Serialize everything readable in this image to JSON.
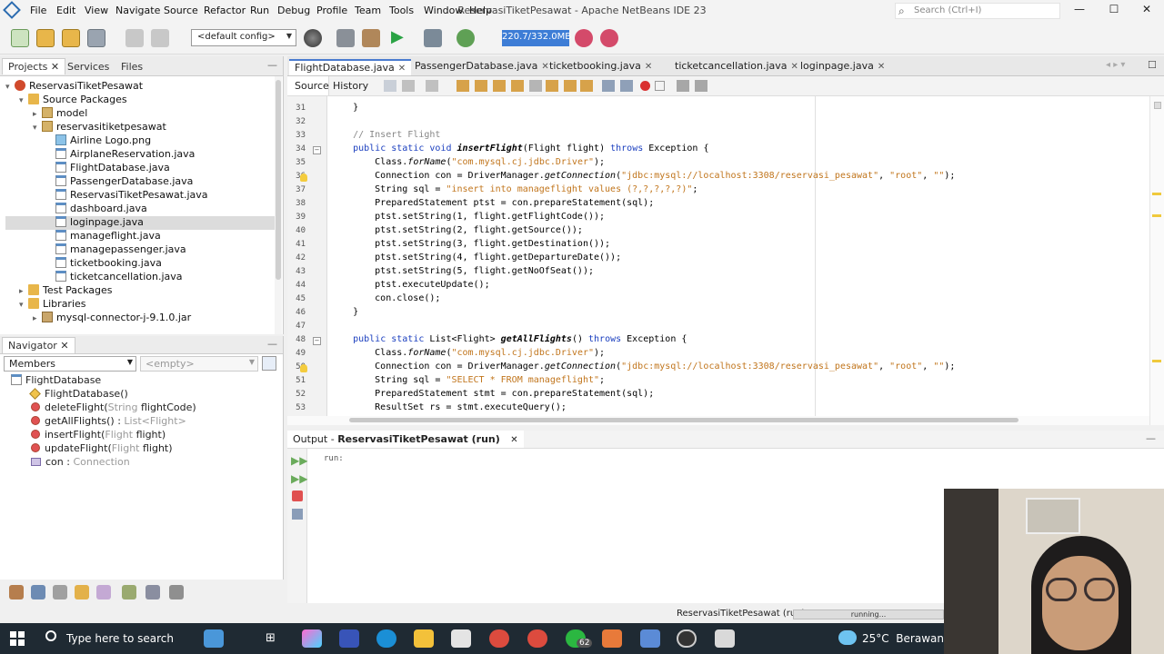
{
  "window": {
    "title": "ReservasiTiketPesawat - Apache NetBeans IDE 23",
    "search_placeholder": "Search (Ctrl+I)"
  },
  "menu": [
    "File",
    "Edit",
    "View",
    "Navigate",
    "Source",
    "Refactor",
    "Run",
    "Debug",
    "Profile",
    "Team",
    "Tools",
    "Window",
    "Help"
  ],
  "toolbar": {
    "config": "<default config>",
    "memory": "220.7/332.0MB"
  },
  "projects": {
    "tabs": [
      "Projects",
      "Services",
      "Files"
    ],
    "tree": [
      {
        "label": "ReservasiTiketPesawat",
        "depth": 0,
        "icon": "project-icon",
        "exp": "▾"
      },
      {
        "label": "Source Packages",
        "depth": 1,
        "icon": "folder-icon",
        "exp": "▾"
      },
      {
        "label": "model",
        "depth": 2,
        "icon": "package-icon",
        "exp": "▸"
      },
      {
        "label": "reservasitiketpesawat",
        "depth": 2,
        "icon": "package-icon",
        "exp": "▾"
      },
      {
        "label": "Airline Logo.png",
        "depth": 3,
        "icon": "image-file-icon",
        "exp": ""
      },
      {
        "label": "AirplaneReservation.java",
        "depth": 3,
        "icon": "java-file-icon",
        "exp": ""
      },
      {
        "label": "FlightDatabase.java",
        "depth": 3,
        "icon": "java-file-icon",
        "exp": ""
      },
      {
        "label": "PassengerDatabase.java",
        "depth": 3,
        "icon": "java-file-icon",
        "exp": ""
      },
      {
        "label": "ReservasiTiketPesawat.java",
        "depth": 3,
        "icon": "java-file-icon",
        "exp": ""
      },
      {
        "label": "dashboard.java",
        "depth": 3,
        "icon": "java-file-icon",
        "exp": ""
      },
      {
        "label": "loginpage.java",
        "depth": 3,
        "icon": "java-file-icon",
        "exp": "",
        "selected": true
      },
      {
        "label": "manageflight.java",
        "depth": 3,
        "icon": "java-file-icon",
        "exp": ""
      },
      {
        "label": "managepassenger.java",
        "depth": 3,
        "icon": "java-file-icon",
        "exp": ""
      },
      {
        "label": "ticketbooking.java",
        "depth": 3,
        "icon": "java-file-icon",
        "exp": ""
      },
      {
        "label": "ticketcancellation.java",
        "depth": 3,
        "icon": "java-file-icon",
        "exp": ""
      },
      {
        "label": "Test Packages",
        "depth": 1,
        "icon": "folder-icon",
        "exp": "▸"
      },
      {
        "label": "Libraries",
        "depth": 1,
        "icon": "folder-icon",
        "exp": "▾"
      },
      {
        "label": "mysql-connector-j-9.1.0.jar",
        "depth": 2,
        "icon": "jar-icon",
        "exp": "▸"
      }
    ]
  },
  "navigator": {
    "title": "Navigator",
    "filter": "Members",
    "filter2": "<empty>",
    "items": [
      {
        "name": "FlightDatabase",
        "type": "",
        "kind": "class"
      },
      {
        "name": "FlightDatabase()",
        "type": "",
        "kind": "ctor"
      },
      {
        "name": "deleteFlight(",
        "type": "String",
        "rest": " flightCode)",
        "kind": "method"
      },
      {
        "name": "getAllFlights() : ",
        "type": "List<Flight>",
        "rest": "",
        "kind": "method"
      },
      {
        "name": "insertFlight(",
        "type": "Flight",
        "rest": " flight)",
        "kind": "method"
      },
      {
        "name": "updateFlight(",
        "type": "Flight",
        "rest": " flight)",
        "kind": "method"
      },
      {
        "name": "con : ",
        "type": "Connection",
        "rest": "",
        "kind": "field"
      }
    ]
  },
  "editor": {
    "tabs": [
      "FlightDatabase.java",
      "PassengerDatabase.java",
      "ticketbooking.java",
      "ticketcancellation.java",
      "loginpage.java"
    ],
    "subtabs": [
      "Source",
      "History"
    ],
    "lines": [
      {
        "n": "31",
        "t": "    }"
      },
      {
        "n": "32",
        "t": ""
      },
      {
        "n": "33",
        "t": "    // Insert Flight"
      },
      {
        "n": "34",
        "t": "    public static void insertFlight(Flight flight) throws Exception {"
      },
      {
        "n": "35",
        "t": "        Class.forName(\"com.mysql.cj.jdbc.Driver\");"
      },
      {
        "n": "36",
        "t": "        Connection con = DriverManager.getConnection(\"jdbc:mysql://localhost:3308/reservasi_pesawat\", \"root\", \"\");"
      },
      {
        "n": "37",
        "t": "        String sql = \"insert into manageflight values (?,?,?,?,?)\";"
      },
      {
        "n": "38",
        "t": "        PreparedStatement ptst = con.prepareStatement(sql);"
      },
      {
        "n": "39",
        "t": "        ptst.setString(1, flight.getFlightCode());"
      },
      {
        "n": "40",
        "t": "        ptst.setString(2, flight.getSource());"
      },
      {
        "n": "41",
        "t": "        ptst.setString(3, flight.getDestination());"
      },
      {
        "n": "42",
        "t": "        ptst.setString(4, flight.getDepartureDate());"
      },
      {
        "n": "43",
        "t": "        ptst.setString(5, flight.getNoOfSeat());"
      },
      {
        "n": "44",
        "t": "        ptst.executeUpdate();"
      },
      {
        "n": "45",
        "t": "        con.close();"
      },
      {
        "n": "46",
        "t": "    }"
      },
      {
        "n": "47",
        "t": ""
      },
      {
        "n": "48",
        "t": "    public static List<Flight> getAllFlights() throws Exception {"
      },
      {
        "n": "49",
        "t": "        Class.forName(\"com.mysql.cj.jdbc.Driver\");"
      },
      {
        "n": "50",
        "t": "        Connection con = DriverManager.getConnection(\"jdbc:mysql://localhost:3308/reservasi_pesawat\", \"root\", \"\");"
      },
      {
        "n": "51",
        "t": "        String sql = \"SELECT * FROM manageflight\";"
      },
      {
        "n": "52",
        "t": "        PreparedStatement stmt = con.prepareStatement(sql);"
      },
      {
        "n": "53",
        "t": "        ResultSet rs = stmt.executeQuery();"
      }
    ]
  },
  "output": {
    "label": "Output - ",
    "target": "ReservasiTiketPesawat (run)",
    "text": "run:"
  },
  "status": {
    "task": "ReservasiTiketPesawat (run)",
    "progress": "running..."
  },
  "taskbar": {
    "search": "Type here to search",
    "badge": "62",
    "temperature": "25°C",
    "weather": "Berawan"
  }
}
